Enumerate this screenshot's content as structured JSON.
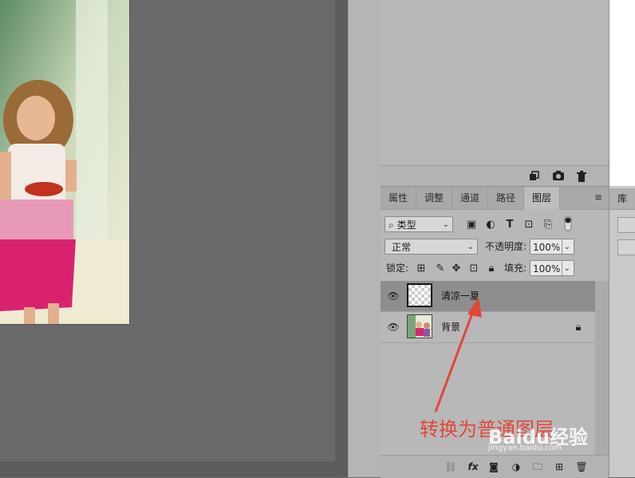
{
  "layers_panel": {
    "tabs": [
      "属性",
      "调整",
      "通道",
      "路径",
      "图层"
    ],
    "active_tab": "图层",
    "filter_kind": "类型",
    "blend_mode": "正常",
    "opacity_label": "不透明度:",
    "opacity_value": "100%",
    "lock_label": "锁定:",
    "fill_label": "填充:",
    "fill_value": "100%",
    "layers": [
      {
        "name": "清凉一夏",
        "selected": true,
        "thumbnail": "transparent"
      },
      {
        "name": "背景",
        "selected": false,
        "thumbnail": "photo",
        "locked": true
      }
    ],
    "footer_icons": [
      "link-icon",
      "fx-icon",
      "mask-icon",
      "adjustment-icon",
      "folder-icon",
      "new-layer-icon",
      "trash-icon"
    ]
  },
  "top_panel": {
    "footer_icons": [
      "new-snapshot-icon",
      "camera-icon",
      "trash-icon"
    ]
  },
  "right_strip": {
    "tab_label": "库"
  },
  "annotation": {
    "text": "转换为普通图层",
    "color": "#e2463a"
  },
  "watermark": {
    "brand": "Baidu经验",
    "url": "jingyan.baidu.com"
  }
}
